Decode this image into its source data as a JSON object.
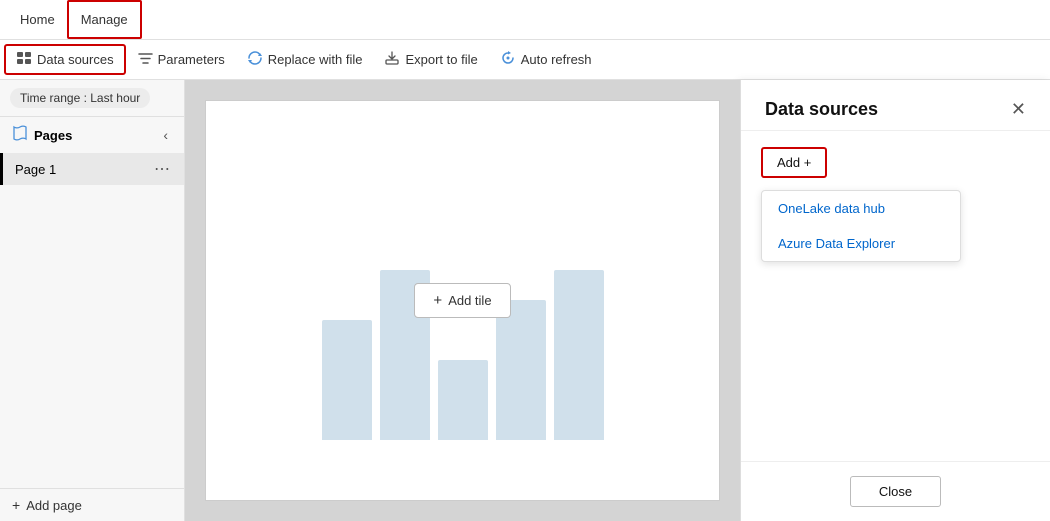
{
  "nav": {
    "home_label": "Home",
    "manage_label": "Manage"
  },
  "toolbar": {
    "datasources_label": "Data sources",
    "parameters_label": "Parameters",
    "replace_label": "Replace with file",
    "export_label": "Export to file",
    "refresh_label": "Auto refresh"
  },
  "time_range": {
    "label": "Time range : Last hour"
  },
  "sidebar": {
    "pages_label": "Pages",
    "page1_label": "Page 1",
    "add_page_label": "Add page"
  },
  "canvas": {
    "add_tile_label": "Add tile"
  },
  "right_panel": {
    "title": "Data sources",
    "close_icon": "✕",
    "add_label": "Add +",
    "menu_item1": "OneLake data hub",
    "menu_item2": "Azure Data Explorer",
    "close_button_label": "Close"
  },
  "icons": {
    "datasource": "⊞",
    "filter": "⚗",
    "replace": "⟳",
    "export": "⬆",
    "refresh": "↻",
    "pages": "⧉",
    "plus": "+",
    "dots": "⋯"
  }
}
